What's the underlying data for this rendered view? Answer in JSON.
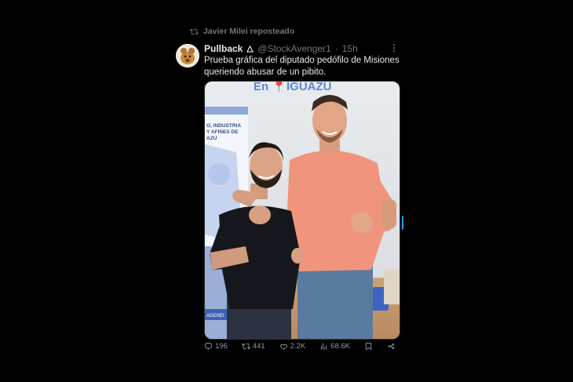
{
  "repost": {
    "label": "Javier Milei reposteado",
    "icon": "repost-icon"
  },
  "author": {
    "name": "Pullback",
    "handle": "@StockAvenger1",
    "separator": "·",
    "time": "15h",
    "badge_icon": "triangle-badge-icon"
  },
  "tweet": {
    "text": "Prueba gráfica del diputado pedófilo de Misiones queriendo abusar de un pibito."
  },
  "media": {
    "banner_text": "En 📍IGUAZU",
    "sign_lines": [
      "O, INDUSTRIA",
      "Y AFINES DE",
      "AZU"
    ],
    "sign_footer": "AGENEI"
  },
  "actions": {
    "replies": "196",
    "reposts": "441",
    "likes": "2.2K",
    "views": "68.6K"
  },
  "colors": {
    "background": "#000000",
    "text": "#e7e9ea",
    "muted": "#71767b",
    "accent": "#1d9bf0"
  }
}
